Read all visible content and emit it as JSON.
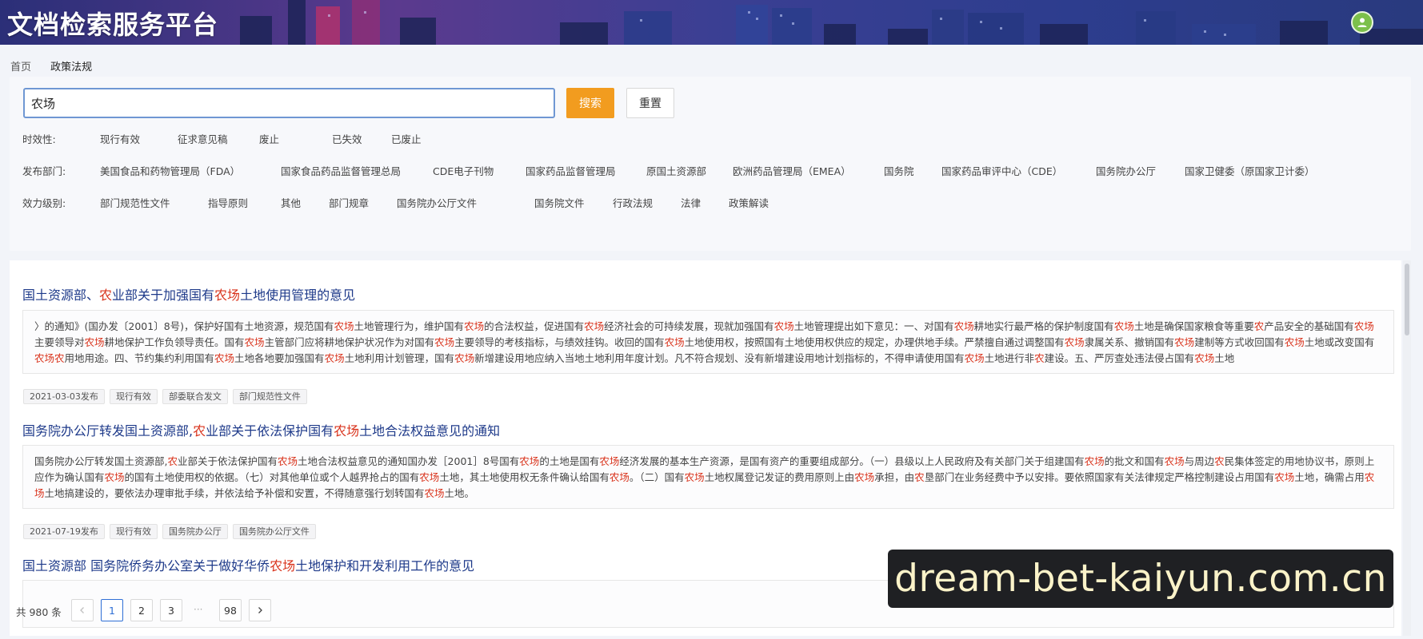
{
  "header": {
    "site_title": "文档检索服务平台",
    "avatar_icon": "user-icon",
    "avatar_color": "#7cc04b"
  },
  "breadcrumb": {
    "home": "首页",
    "current": "政策法规"
  },
  "search": {
    "value": "农场",
    "search_label": "搜索",
    "reset_label": "重置",
    "search_button_color": "#f29c1f"
  },
  "filters": {
    "validity": {
      "label": "时效性:",
      "options": [
        "现行有效",
        "征求意见稿",
        "废止",
        "已失效",
        "已废止"
      ]
    },
    "department": {
      "label": "发布部门:",
      "options": [
        "美国食品和药物管理局（FDA）",
        "国家食品药品监督管理总局",
        "CDE电子刊物",
        "国家药品监督管理局",
        "原国土资源部",
        "欧洲药品管理局（EMEA）",
        "国务院",
        "国家药品审评中心（CDE）",
        "国务院办公厅",
        "国家卫健委（原国家卫计委）"
      ]
    },
    "level": {
      "label": "效力级别:",
      "options": [
        "部门规范性文件",
        "指导原则",
        "其他",
        "部门规章",
        "国务院办公厅文件",
        "国务院文件",
        "行政法规",
        "法律",
        "政策解读"
      ]
    }
  },
  "results": [
    {
      "title_parts": [
        {
          "t": "国土资源部、",
          "h": false
        },
        {
          "t": "农",
          "h": true
        },
        {
          "t": "业部关于加强国有",
          "h": false
        },
        {
          "t": "农场",
          "h": true
        },
        {
          "t": "土地使用管理的意见",
          "h": false
        }
      ],
      "summary_parts": [
        {
          "t": "〉的通知》(国办发〔2001〕8号)，保护好国有土地资源，规范国有",
          "h": false
        },
        {
          "t": "农场",
          "h": true
        },
        {
          "t": "土地管理行为，维护国有",
          "h": false
        },
        {
          "t": "农场",
          "h": true
        },
        {
          "t": "的合法权益，促进国有",
          "h": false
        },
        {
          "t": "农场",
          "h": true
        },
        {
          "t": "经济社会的可持续发展，现就加强国有",
          "h": false
        },
        {
          "t": "农场",
          "h": true
        },
        {
          "t": "土地管理提出如下意见：一、对国有",
          "h": false
        },
        {
          "t": "农场",
          "h": true
        },
        {
          "t": "耕地实行最严格的保护制度国有",
          "h": false
        },
        {
          "t": "农场",
          "h": true
        },
        {
          "t": "土地是确保国家粮食等重要",
          "h": false
        },
        {
          "t": "农",
          "h": true
        },
        {
          "t": "产品安全的基础国有",
          "h": false
        },
        {
          "t": "农场",
          "h": true
        },
        {
          "t": "主要领导对",
          "h": false
        },
        {
          "t": "农场",
          "h": true
        },
        {
          "t": "耕地保护工作负领导责任。国有",
          "h": false
        },
        {
          "t": "农场",
          "h": true
        },
        {
          "t": "主管部门应将耕地保护状况作为对国有",
          "h": false
        },
        {
          "t": "农场",
          "h": true
        },
        {
          "t": "主要领导的考核指标，与绩效挂钩。收回的国有",
          "h": false
        },
        {
          "t": "农场",
          "h": true
        },
        {
          "t": "土地使用权，按照国有土地使用权供应的规定，办理供地手续。严禁擅自通过调整国有",
          "h": false
        },
        {
          "t": "农场",
          "h": true
        },
        {
          "t": "隶属关系、撤销国有",
          "h": false
        },
        {
          "t": "农场",
          "h": true
        },
        {
          "t": "建制等方式收回国有",
          "h": false
        },
        {
          "t": "农场",
          "h": true
        },
        {
          "t": "土地或改变国有",
          "h": false
        },
        {
          "t": "农场农",
          "h": true
        },
        {
          "t": "用地用途。四、节约集约利用国有",
          "h": false
        },
        {
          "t": "农场",
          "h": true
        },
        {
          "t": "土地各地要加强国有",
          "h": false
        },
        {
          "t": "农场",
          "h": true
        },
        {
          "t": "土地利用计划管理，国有",
          "h": false
        },
        {
          "t": "农场",
          "h": true
        },
        {
          "t": "新增建设用地应纳入当地土地利用年度计划。凡不符合规划、没有新增建设用地计划指标的，不得申请使用国有",
          "h": false
        },
        {
          "t": "农场",
          "h": true
        },
        {
          "t": "土地进行非",
          "h": false
        },
        {
          "t": "农",
          "h": true
        },
        {
          "t": "建设。五、严厉查处违法侵占国有",
          "h": false
        },
        {
          "t": "农场",
          "h": true
        },
        {
          "t": "土地",
          "h": false
        }
      ],
      "tags": [
        "2021-03-03发布",
        "现行有效",
        "部委联合发文",
        "部门规范性文件"
      ]
    },
    {
      "title_parts": [
        {
          "t": "国务院办公厅转发国土资源部,",
          "h": false
        },
        {
          "t": "农",
          "h": true
        },
        {
          "t": "业部关于依法保护国有",
          "h": false
        },
        {
          "t": "农场",
          "h": true
        },
        {
          "t": "土地合法权益意见的通知",
          "h": false
        }
      ],
      "summary_parts": [
        {
          "t": "国务院办公厅转发国土资源部,",
          "h": false
        },
        {
          "t": "农",
          "h": true
        },
        {
          "t": "业部关于依法保护国有",
          "h": false
        },
        {
          "t": "农场",
          "h": true
        },
        {
          "t": "土地合法权益意见的通知国办发［2001］8号国有",
          "h": false
        },
        {
          "t": "农场",
          "h": true
        },
        {
          "t": "的土地是国有",
          "h": false
        },
        {
          "t": "农场",
          "h": true
        },
        {
          "t": "经济发展的基本生产资源，是国有资产的重要组成部分。（一）县级以上人民政府及有关部门关于组建国有",
          "h": false
        },
        {
          "t": "农场",
          "h": true
        },
        {
          "t": "的批文和国有",
          "h": false
        },
        {
          "t": "农场",
          "h": true
        },
        {
          "t": "与周边",
          "h": false
        },
        {
          "t": "农",
          "h": true
        },
        {
          "t": "民集体签定的用地协议书，原则上应作为确认国有",
          "h": false
        },
        {
          "t": "农场",
          "h": true
        },
        {
          "t": "的国有土地使用权的依据。（七）对其他单位或个人越界抢占的国有",
          "h": false
        },
        {
          "t": "农场",
          "h": true
        },
        {
          "t": "土地，其土地使用权无条件确认给国有",
          "h": false
        },
        {
          "t": "农场",
          "h": true
        },
        {
          "t": "。（二）国有",
          "h": false
        },
        {
          "t": "农场",
          "h": true
        },
        {
          "t": "土地权属登记发证的费用原则上由",
          "h": false
        },
        {
          "t": "农场",
          "h": true
        },
        {
          "t": "承担，由",
          "h": false
        },
        {
          "t": "农",
          "h": true
        },
        {
          "t": "垦部门在业务经费中予以安排。要依照国家有关法律规定严格控制建设占用国有",
          "h": false
        },
        {
          "t": "农场",
          "h": true
        },
        {
          "t": "土地，确需占用",
          "h": false
        },
        {
          "t": "农场",
          "h": true
        },
        {
          "t": "土地搞建设的，要依法办理审批手续，并依法给予补偿和安置，不得随意强行划转国有",
          "h": false
        },
        {
          "t": "农场",
          "h": true
        },
        {
          "t": "土地。",
          "h": false
        }
      ],
      "tags": [
        "2021-07-19发布",
        "现行有效",
        "国务院办公厅",
        "国务院办公厅文件"
      ]
    },
    {
      "title_parts": [
        {
          "t": "国土资源部 国务院侨务办公室关于做好华侨",
          "h": false
        },
        {
          "t": "农场",
          "h": true
        },
        {
          "t": "土地保护和开发利用工作的意见",
          "h": false
        }
      ]
    }
  ],
  "pagination": {
    "total": "共 980 条",
    "prev_icon": "chevron-left-icon",
    "next_icon": "chevron-right-icon",
    "pages": [
      "1",
      "2",
      "3",
      "98"
    ],
    "ellipsis": "···",
    "current": "1"
  },
  "banner": {
    "text": "dream-bet-kaiyun.com.cn"
  },
  "colors": {
    "highlight": "#d9331c",
    "title_link": "#1e3a8a",
    "active_page": "#2f6fd6"
  }
}
